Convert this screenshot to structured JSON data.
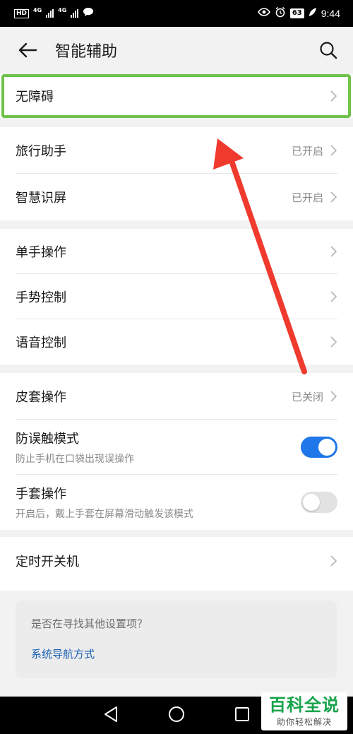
{
  "status_bar": {
    "hd_label": "HD",
    "net1": "4G",
    "net2": "4G",
    "battery": "63",
    "time": "9:44"
  },
  "app_bar": {
    "title": "智能辅助"
  },
  "groups": {
    "g1": {
      "accessibility": "无障碍"
    },
    "g2": {
      "travel_assistant": {
        "label": "旅行助手",
        "value": "已开启"
      },
      "smart_screen": {
        "label": "智慧识屏",
        "value": "已开启"
      }
    },
    "g3": {
      "one_hand": "单手操作",
      "gesture": "手势控制",
      "voice": "语音控制"
    },
    "g4": {
      "flip_cover": {
        "label": "皮套操作",
        "value": "已关闭"
      },
      "pocket_mode": {
        "label": "防误触模式",
        "sub": "防止手机在口袋出现误操作",
        "enabled": true
      },
      "glove_mode": {
        "label": "手套操作",
        "sub": "开启后，戴上手套在屏幕滑动触发该模式",
        "enabled": false
      }
    },
    "g5": {
      "scheduled_power": "定时开关机"
    }
  },
  "tip": {
    "question": "是否在寻找其他设置项？",
    "link": "系统导航方式"
  },
  "watermark": {
    "big": "百科全说",
    "small": "助你轻松解决"
  },
  "colors": {
    "accent_blue": "#1f77e9",
    "highlight_green": "#6fc24a",
    "arrow_red": "#f03a2e"
  }
}
